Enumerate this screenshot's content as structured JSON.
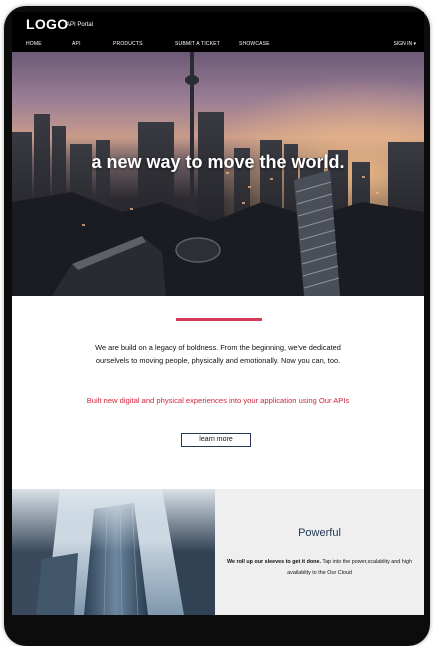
{
  "header": {
    "logo": "LOGO",
    "portal_label": "API Portal",
    "nav": [
      "HOME",
      "API",
      "PRODUCTS",
      "SUBMIT A TICKET",
      "SHOWCASE"
    ],
    "sign_in": "SIGN IN",
    "sign_in_caret": "▾"
  },
  "hero": {
    "title": "a new way to move the world."
  },
  "intro": {
    "text": "We are build on a legacy of boldness. From the beginning, we've dedicated ourselvels to moving people, physically and emotionally. Now you can, too.",
    "highlight": "Built new digital and physical experiences into your application using Our APIs",
    "button": "learn more"
  },
  "feature": {
    "title": "Powerful",
    "bold": "We roll up our sleeves to get it done.",
    "text": " Tap into the power,scalablity and high availablity to the Our Cloud"
  },
  "colors": {
    "accent": "#d23a57",
    "navy": "#233a57"
  }
}
